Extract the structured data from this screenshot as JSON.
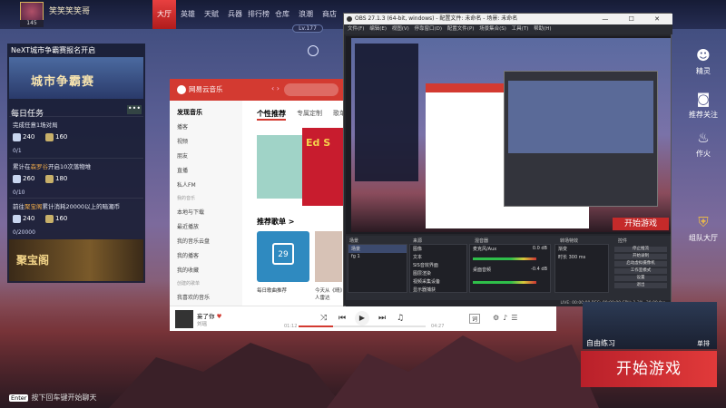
{
  "player": {
    "name": "笑笑笑笑哥",
    "level": "145"
  },
  "nav": [
    "大厅",
    "英雄",
    "天赋",
    "兵器",
    "排行榜",
    "仓库",
    "浪潮",
    "商店"
  ],
  "level_pill": "Lv.177",
  "news": {
    "title": "NeXT城市争霸赛报名开启",
    "banner_text": "城市争霸赛"
  },
  "daily": {
    "title": "每日任务",
    "more": "•••",
    "tasks": [
      {
        "pre": "完成任意1场对局",
        "hl": "",
        "post": "",
        "rewards": [
          "240",
          "160"
        ],
        "progress": "0/1"
      },
      {
        "pre": "累计在",
        "hl": "森罗谷",
        "post": "开启10次落物堆",
        "rewards": [
          "260",
          "180"
        ],
        "progress": "0/10"
      },
      {
        "pre": "前往",
        "hl": "聚宝阁",
        "post": "累计消耗20000以上的暗潮币",
        "rewards": [
          "240",
          "160"
        ],
        "progress": "0/20000"
      }
    ]
  },
  "treasure": "聚宝阁",
  "music": {
    "app": "网易云音乐",
    "side": [
      "发现音乐",
      "播客",
      "视频",
      "朋友",
      "直播",
      "私人FM",
      "我的音乐",
      "本地与下载",
      "最近播放",
      "我的音乐云盘",
      "我的播客",
      "我的收藏",
      "创建的歌单",
      "我喜欢的音乐"
    ],
    "tabs": [
      "个性推荐",
      "专属定制",
      "歌单"
    ],
    "banner_text": "Ed S",
    "rec_title": "推荐歌单 >",
    "rec_day": "29",
    "rec_cap1": "每日歌曲推荐",
    "rec_cap2": "今天从《晴》私人雷达",
    "song": "妄了你",
    "artist": "刘瑶",
    "time_cur": "01:12",
    "time_total": "04:27",
    "progress": 0.27,
    "lyric": "词"
  },
  "obs": {
    "title": "OBS 27.1.3 (64-bit, windows) - 配置文件: 未命名 - 场景: 未命名",
    "menu": "文件(F) 编辑(E) 视图(V) 停靠窗口(D) 配置文件(P) 场景集合(S) 工具(T) 帮助(H)",
    "mini_start": "开始游戏",
    "docks": [
      "场景",
      "来源",
      "混音器",
      "转场特效",
      "控件"
    ],
    "scenes": [
      "场景",
      "fg 1"
    ],
    "sources": [
      "图像",
      "文本",
      "SIS音效界面",
      "图层渲染",
      "视频采集设备",
      "显示器捕获"
    ],
    "mixer": [
      "麦克风/Aux",
      "桌面音频"
    ],
    "mixer_db": [
      "0.0 dB",
      "-0.4 dB"
    ],
    "transition": {
      "type": "渐变",
      "duration_label": "时长",
      "duration": "300 ms"
    },
    "controls": [
      "停止推流",
      "开始录制",
      "启动虚拟摄像机",
      "工作室模式",
      "设置",
      "退出"
    ],
    "status": "LIVE: 00:00:00   REC: 00:00:00   CPU: 1.3%, 30.00 fps"
  },
  "right": [
    {
      "icon": "elf-icon",
      "label": "精灵"
    },
    {
      "icon": "camera-icon",
      "label": "推荐关注"
    },
    {
      "icon": "fire-icon",
      "label": "作火"
    },
    {
      "icon": "team-icon",
      "label": "组队大厅"
    }
  ],
  "practice": {
    "label": "自由练习",
    "solo": "单排"
  },
  "start": "开始游戏",
  "hint": {
    "key": "Enter",
    "text": "按下回车键开始聊天"
  },
  "colors": {
    "accent": "#d33a31",
    "gold": "#f5d78a"
  }
}
